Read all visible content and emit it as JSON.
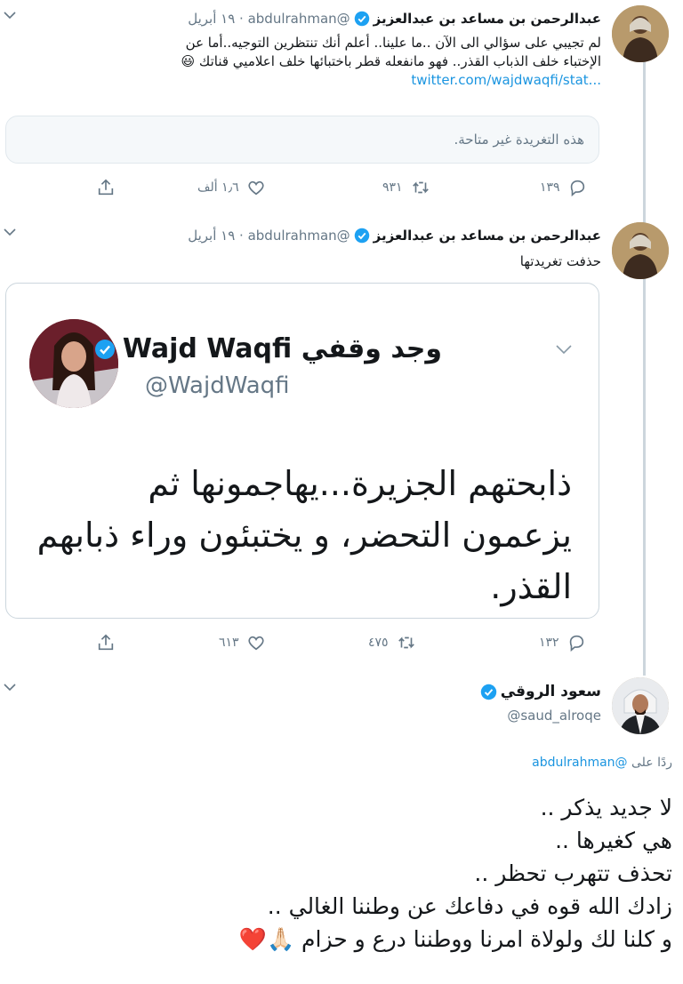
{
  "tweet1": {
    "name": "عبدالرحمن بن مساعد بن عبدالعزيز",
    "meta": "@abdulrahman · ١٩ أبريل",
    "text_line1": "لم تجيبي على سؤالي الى الآن ..ما علينا.. أعلم أنك تنتظرين التوجيه..أما عن",
    "text_line2": "الإختباء خلف الذباب القذر.. فهو مانفعله قطر باختبائها خلف اعلاميي قناتك 😃",
    "link": "twitter.com/wajdwaqfi/stat...",
    "unavailable": "هذه التغريدة غير متاحة.",
    "replies": "١٣٩",
    "retweets": "٩٣١",
    "likes": "١٫٦ ألف"
  },
  "tweet2": {
    "name": "عبدالرحمن بن مساعد بن عبدالعزيز",
    "meta": "@abdulrahman · ١٩ أبريل",
    "text": "حذفت تغريدتها",
    "replies": "١٣٢",
    "retweets": "٤٧٥",
    "likes": "٦١٣",
    "embedded": {
      "name": "وجد وقفي Wajd Waqfi",
      "handle": "@WajdWaqfi",
      "line1": "ذابحتهم الجزيرة...يهاجمونها ثم",
      "line2": "يزعمون التحضر، و يختبئون وراء ذبابهم",
      "line3": "القذر."
    }
  },
  "tweet3": {
    "name": "سعود الروقي",
    "handle": "@saud_alroqe",
    "reply_prefix": "ردًا على",
    "reply_handle": "@abdulrahman",
    "line1": "لا جديد يذكر ..",
    "line2": "هي كغيرها ..",
    "line3": "تحذف تتهرب تحظر ..",
    "line4": "زادك الله قوه في دفاعك عن وطننا الغالي ..",
    "line5": "و كلنا لك ولولاة امرنا ووطننا درع و حزام 🙏🏻❤️"
  },
  "colors": {
    "accent": "#1b95e0",
    "muted": "#657786",
    "border": "#ccd6dd",
    "like_heart": "#c6162d"
  }
}
